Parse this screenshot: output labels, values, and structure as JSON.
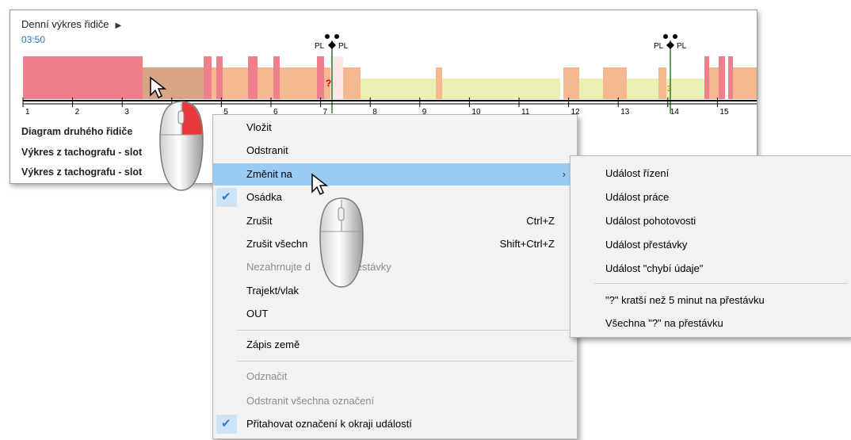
{
  "chart": {
    "title": "Denní výkres řidiče",
    "title_arrow": "▶",
    "time": "03:50",
    "marker_label_left": "PL",
    "marker_label_right": "PL",
    "question_mark": "?",
    "small_mark": "3",
    "axis_ticks": [
      "1",
      "2",
      "3",
      "4",
      "5",
      "6",
      "7",
      "8",
      "9",
      "10",
      "11",
      "12",
      "13",
      "14",
      "15"
    ],
    "rows": [
      "Diagram druhého řidiče",
      "Výkres z tachografu - slot",
      "Výkres z tachografu - slot"
    ]
  },
  "menu": {
    "items": [
      {
        "label": "Vložit"
      },
      {
        "label": "Odstranit"
      },
      {
        "label": "Změnit na",
        "submenu_arrow": "›"
      },
      {
        "label": "Osádka",
        "check": "✔"
      },
      {
        "label": "Zrušit",
        "shortcut": "Ctrl+Z"
      },
      {
        "label": "Zrušit všechn",
        "shortcut": "Shift+Ctrl+Z"
      },
      {
        "label": "Nezahrnujte d          y přestávky"
      },
      {
        "label": "Trajekt/vlak"
      },
      {
        "label": "OUT"
      },
      {
        "label": "Zápis země"
      },
      {
        "label": "Odznačit"
      },
      {
        "label": "Odstranit všechna označení"
      },
      {
        "label": "Přitahovat označení k okraji událostí",
        "check": "✔"
      }
    ]
  },
  "submenu": {
    "items": [
      {
        "label": "Událost řízení"
      },
      {
        "label": "Událost práce"
      },
      {
        "label": "Událost pohotovosti"
      },
      {
        "label": "Událost přestávky"
      },
      {
        "label": "Událost \"chybí údaje\""
      },
      {
        "label": "\"?\" kratší než 5 minut na přestávku"
      },
      {
        "label": "Všechna \"?\" na přestávku"
      }
    ]
  },
  "colors": {
    "driving": "#f07f8c",
    "work": "#f6b98f",
    "rest": "#ecefb3",
    "selected": "#d7a585",
    "highlight": "#99ccf5",
    "accent_text": "#2a78c2"
  }
}
